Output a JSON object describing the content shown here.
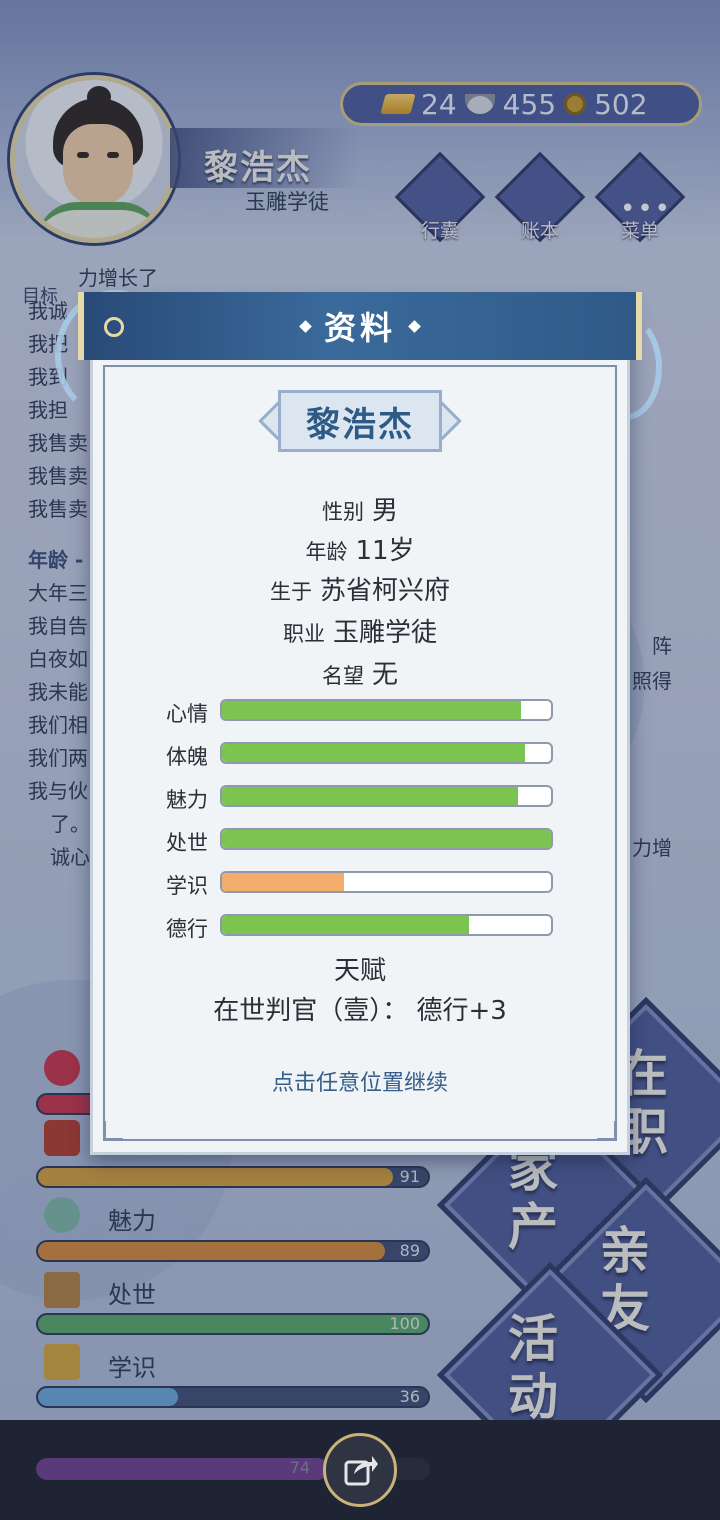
{
  "player": {
    "name": "黎浩杰",
    "title": "玉雕学徒"
  },
  "currency": {
    "gold": "24",
    "silver": "455",
    "copper": "502"
  },
  "menu": {
    "bag": "行囊",
    "ledger": "账本",
    "menu": "菜单"
  },
  "log": {
    "target_tag": "目标",
    "lines_top": [
      "力增长了",
      "我诚",
      "我把",
      "我到",
      "我担",
      "我售卖",
      "我售卖",
      "我售卖"
    ],
    "age_heading": "年龄 -",
    "lines_bottom": [
      "大年三",
      "我自告",
      "白夜如",
      "我未能",
      "我们相",
      "我们两",
      "我与伙",
      "了。",
      "诚心"
    ],
    "right_fragments": [
      "阵",
      "照得",
      "力增"
    ]
  },
  "background_stats": [
    {
      "label": "",
      "value": "91",
      "percent": 91,
      "color": "#d4a03a"
    },
    {
      "label": "魅力",
      "value": "89",
      "percent": 89,
      "color": "#d48a3a"
    },
    {
      "label": "处世",
      "value": "100",
      "percent": 100,
      "color": "#58a86a"
    },
    {
      "label": "学识",
      "value": "36",
      "percent": 36,
      "color": "#6aa8d8"
    },
    {
      "label": "德行",
      "value": "74",
      "percent": 74,
      "color": "#5a3a7a"
    }
  ],
  "side_buttons": {
    "job": "在\n职",
    "property": "家\n产",
    "friends": "亲\n友",
    "activity": "活\n动"
  },
  "dialog": {
    "title": "资料",
    "name": "黎浩杰",
    "gender_label": "性别",
    "gender": "男",
    "age_label": "年龄",
    "age": "11岁",
    "birthplace_label": "生于",
    "birthplace": "苏省柯兴府",
    "job_label": "职业",
    "job": "玉雕学徒",
    "fame_label": "名望",
    "fame": "无",
    "attributes": [
      {
        "label": "心情",
        "fraction": 0.91,
        "color": "#7bc44f"
      },
      {
        "label": "体魄",
        "fraction": 0.92,
        "color": "#7bc44f"
      },
      {
        "label": "魅力",
        "fraction": 0.9,
        "color": "#7bc44f"
      },
      {
        "label": "处世",
        "fraction": 1.0,
        "color": "#7bc44f"
      },
      {
        "label": "学识",
        "fraction": 0.37,
        "color": "#f2ad6a"
      },
      {
        "label": "德行",
        "fraction": 0.75,
        "color": "#7bc44f"
      }
    ],
    "talent_label": "天赋",
    "talent": "在世判官（壹）： 德行+3",
    "continue_hint": "点击任意位置继续"
  }
}
